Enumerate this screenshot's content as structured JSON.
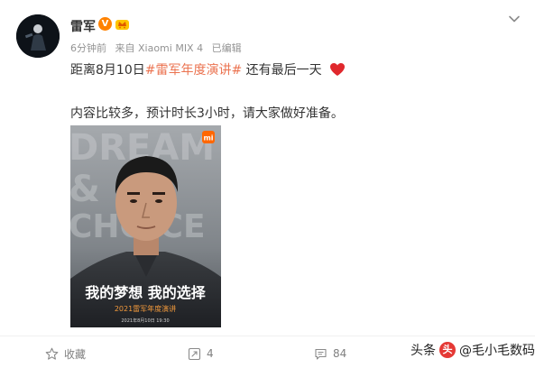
{
  "post": {
    "author": {
      "name": "雷军",
      "verified_badge": "V",
      "meta_time": "6分钟前",
      "meta_source": "来自 Xiaomi MIX 4",
      "meta_edited": "已编辑"
    },
    "text_line1_prefix": "距离8月10日",
    "topic": "#雷军年度演讲#",
    "text_line1_suffix": " 还有最后一天",
    "text_line2": "内容比较多，预计时长3小时，请大家做好准备。",
    "image": {
      "bg_words": [
        "DREAM",
        "&",
        "CHOICE"
      ],
      "logo": "mi",
      "headline": "我的梦想 我的选择",
      "subtitle": "2021雷军年度演讲",
      "footer_note": "2021年8月10日 19:30"
    }
  },
  "actions": {
    "favorite_label": "收藏",
    "repost_count": "4",
    "comment_count": "84"
  },
  "watermark": {
    "platform": "头条",
    "handle": "@毛小毛数码"
  },
  "colors": {
    "topic": "#eb7350",
    "heart": "#e0282d",
    "badge": "#ff8200"
  }
}
